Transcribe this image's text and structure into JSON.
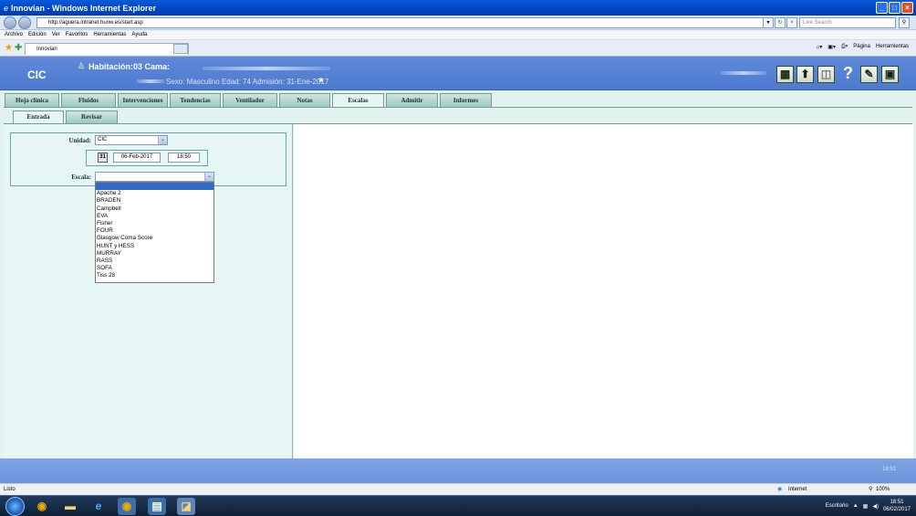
{
  "browser": {
    "window_title": "Innovian - Windows Internet Explorer",
    "address": "http://aguera.intranet.hunw.es/start.asp",
    "search_placeholder": "Live Search",
    "menu": [
      "Archivo",
      "Edición",
      "Ver",
      "Favoritos",
      "Herramientas",
      "Ayuda"
    ],
    "tab_title": "Innovian",
    "commands": {
      "pagina": "Página",
      "herramientas": "Herramientas"
    }
  },
  "app": {
    "unit_badge": "CIC",
    "room": "Habitación:03 Cama:",
    "patient_info": "Sexo: Masculino   Edad: 74   Admisión: 31-Ene-2017",
    "header_icons": [
      "grid-icon",
      "person-icon",
      "window-icon",
      "help-icon",
      "pen-icon",
      "lock-icon"
    ],
    "help_glyph": "?"
  },
  "main_tabs": [
    {
      "label": "Hoja clínica",
      "active": false
    },
    {
      "label": "Fluidos",
      "active": false
    },
    {
      "label": "Intervenciones",
      "active": false
    },
    {
      "label": "Tendencias",
      "active": false
    },
    {
      "label": "Ventilador",
      "active": false
    },
    {
      "label": "Notas",
      "active": false
    },
    {
      "label": "Escalas",
      "active": true
    },
    {
      "label": "Admitir",
      "active": false
    },
    {
      "label": "Informes",
      "active": false
    }
  ],
  "sub_tabs": [
    {
      "label": "Entrada",
      "active": true
    },
    {
      "label": "Revisar",
      "active": false
    }
  ],
  "form": {
    "unidad_label": "Unidad:",
    "unidad_value": "CIC",
    "date": "06-Feb-2017",
    "time": "18:50",
    "escala_label": "Escala:",
    "escala_value": "",
    "calendar_glyph": "31",
    "escala_options": [
      "",
      "Apache 2",
      "BRADEN",
      "Campbell",
      "EVA",
      "Fisher",
      "FOUR",
      "Glasgow Coma Score",
      "HUNT y HESS",
      "MURRAY",
      "RASS",
      "SOFA",
      "Tiss 28"
    ]
  },
  "footer": {
    "clock": "18:51"
  },
  "status": {
    "left": "Listo",
    "zone": "Internet",
    "zoom": "100%"
  },
  "taskbar": {
    "escritorio": "Escritorio",
    "time": "18:51",
    "date": "06/02/2017"
  }
}
